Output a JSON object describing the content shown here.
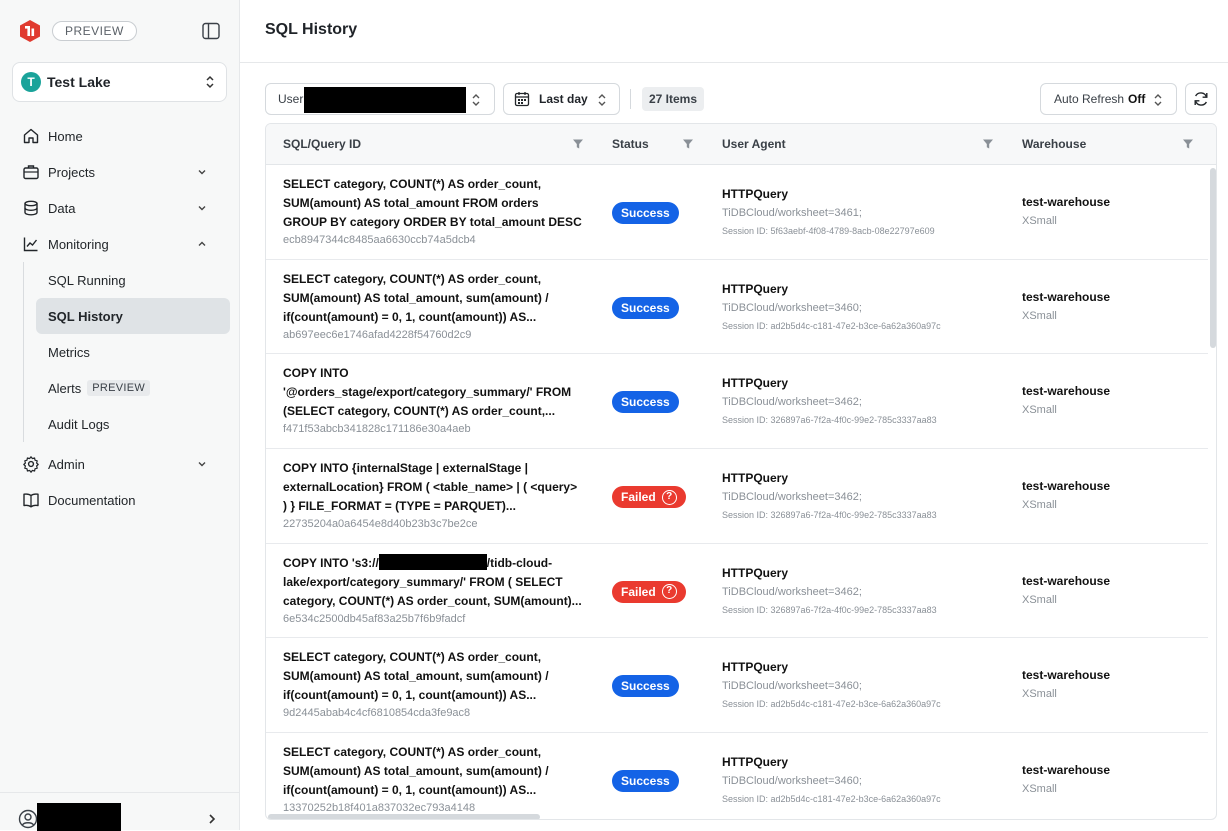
{
  "sidebar": {
    "preview_badge": "PREVIEW",
    "lake": {
      "initial": "T",
      "name": "Test Lake"
    },
    "nav": {
      "home": "Home",
      "projects": "Projects",
      "data": "Data",
      "monitoring": "Monitoring",
      "sub": {
        "sql_running": "SQL Running",
        "sql_history": "SQL History",
        "metrics": "Metrics",
        "alerts": "Alerts",
        "alerts_badge": "PREVIEW",
        "audit_logs": "Audit Logs"
      },
      "admin": "Admin",
      "documentation": "Documentation"
    }
  },
  "page": {
    "title": "SQL History"
  },
  "toolbar": {
    "user_label": "User",
    "date_range": "Last day",
    "item_count": "27 Items",
    "auto_refresh_label": "Auto Refresh",
    "auto_refresh_value": "Off"
  },
  "table": {
    "columns": {
      "query": "SQL/Query ID",
      "status": "Status",
      "user_agent": "User Agent",
      "warehouse": "Warehouse"
    },
    "rows": [
      {
        "query": "SELECT category, COUNT(*) AS order_count, SUM(amount) AS total_amount FROM orders GROUP BY category ORDER BY total_amount DESC",
        "id": "ecb8947344c8485aa6630ccb74a5dcb4",
        "status": "Success",
        "ua": "HTTPQuery",
        "ws": "TiDBCloud/worksheet=3461;",
        "session": "Session ID: 5f63aebf-4f08-4789-8acb-08e22797e609",
        "warehouse": "test-warehouse",
        "size": "XSmall"
      },
      {
        "query": "SELECT category, COUNT(*) AS order_count, SUM(amount) AS total_amount, sum(amount) / if(count(amount) = 0, 1, count(amount)) AS...",
        "id": "ab697eec6e1746afad4228f54760d2c9",
        "status": "Success",
        "ua": "HTTPQuery",
        "ws": "TiDBCloud/worksheet=3460;",
        "session": "Session ID: ad2b5d4c-c181-47e2-b3ce-6a62a360a97c",
        "warehouse": "test-warehouse",
        "size": "XSmall"
      },
      {
        "query": "COPY INTO '@orders_stage/export/category_summary/' FROM (SELECT category, COUNT(*) AS order_count,...",
        "id": "f471f53abcb341828c171186e30a4aeb",
        "status": "Success",
        "ua": "HTTPQuery",
        "ws": "TiDBCloud/worksheet=3462;",
        "session": "Session ID: 326897a6-7f2a-4f0c-99e2-785c3337aa83",
        "warehouse": "test-warehouse",
        "size": "XSmall"
      },
      {
        "query": "COPY INTO {internalStage | externalStage | externalLocation} FROM ( <table_name> | ( <query> ) } FILE_FORMAT = (TYPE = PARQUET)...",
        "id": "22735204a0a6454e8d40b23b3c7be2ce",
        "status": "Failed",
        "ua": "HTTPQuery",
        "ws": "TiDBCloud/worksheet=3462;",
        "session": "Session ID: 326897a6-7f2a-4f0c-99e2-785c3337aa83",
        "warehouse": "test-warehouse",
        "size": "XSmall"
      },
      {
        "query_pre": "COPY INTO 's3://",
        "query_post": "/tidb-cloud-lake/export/category_summary/' FROM ( SELECT category, COUNT(*) AS order_count, SUM(amount)...",
        "id": "6e534c2500db45af83a25b7f6b9fadcf",
        "status": "Failed",
        "ua": "HTTPQuery",
        "ws": "TiDBCloud/worksheet=3462;",
        "session": "Session ID: 326897a6-7f2a-4f0c-99e2-785c3337aa83",
        "warehouse": "test-warehouse",
        "size": "XSmall"
      },
      {
        "query": "SELECT category, COUNT(*) AS order_count, SUM(amount) AS total_amount, sum(amount) / if(count(amount) = 0, 1, count(amount)) AS...",
        "id": "9d2445abab4c4cf6810854cda3fe9ac8",
        "status": "Success",
        "ua": "HTTPQuery",
        "ws": "TiDBCloud/worksheet=3460;",
        "session": "Session ID: ad2b5d4c-c181-47e2-b3ce-6a62a360a97c",
        "warehouse": "test-warehouse",
        "size": "XSmall"
      },
      {
        "query": "SELECT category, COUNT(*) AS order_count, SUM(amount) AS total_amount, sum(amount) / if(count(amount) = 0, 1, count(amount)) AS...",
        "id": "13370252b18f401a837032ec793a4148",
        "status": "Success",
        "ua": "HTTPQuery",
        "ws": "TiDBCloud/worksheet=3460;",
        "session": "Session ID: ad2b5d4c-c181-47e2-b3ce-6a62a360a97c",
        "warehouse": "test-warehouse",
        "size": "XSmall"
      }
    ]
  },
  "colors": {
    "success": "#1463e6",
    "failed": "#ea3a2f",
    "brand": "#e03a2f",
    "avatar": "#1aa39a"
  }
}
